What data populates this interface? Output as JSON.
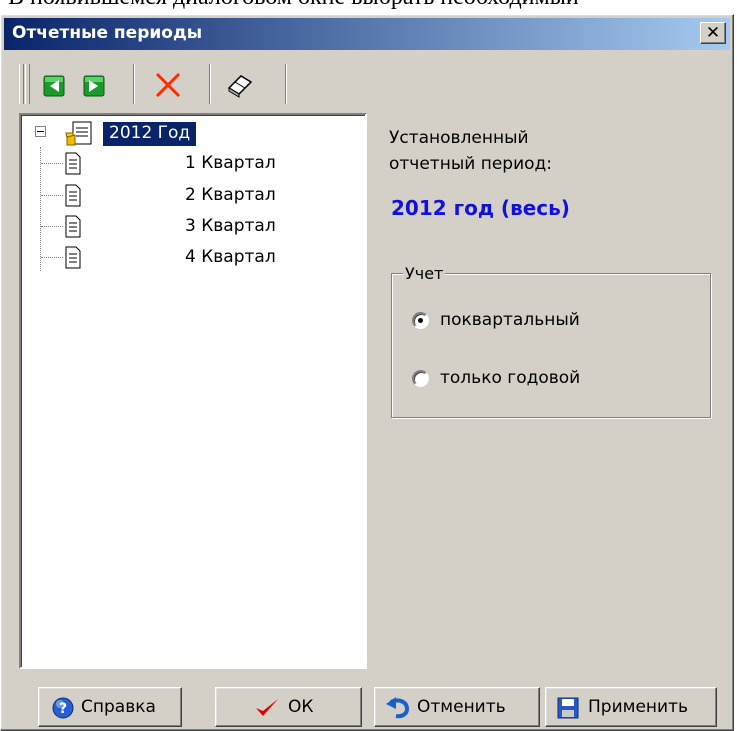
{
  "behind_text": "В появившемся диалоговом окне выбрать необходимый",
  "window": {
    "title": "Отчетные периоды",
    "close_label": "✕"
  },
  "toolbar": {
    "buttons": [
      {
        "name": "prev-period-button",
        "icon": "green-left-arrow-icon"
      },
      {
        "name": "next-period-button",
        "icon": "green-right-arrow-icon"
      },
      {
        "name": "delete-period-button",
        "icon": "red-cross-icon"
      },
      {
        "name": "edit-period-button",
        "icon": "eraser-icon"
      }
    ]
  },
  "tree": {
    "root": {
      "label": "2012 Год",
      "selected": true,
      "expanded": true
    },
    "children": [
      {
        "label": "1 Квартал"
      },
      {
        "label": "2 Квартал"
      },
      {
        "label": "3 Квартал"
      },
      {
        "label": "4 Квартал"
      }
    ]
  },
  "info": {
    "label": "Установленный отчетный период:",
    "value": "2012 год (весь)",
    "value_color": "#1010e0"
  },
  "accounting": {
    "title": "Учет",
    "options": [
      {
        "label": "поквартальный",
        "checked": true
      },
      {
        "label": "только годовой",
        "checked": false
      }
    ]
  },
  "buttons": {
    "help": "Справка",
    "ok": "ОК",
    "cancel": "Отменить",
    "apply": "Применить"
  },
  "colors": {
    "face": "#d4d0c8",
    "title_start": "#0a246a",
    "title_end": "#a6caf0",
    "selection": "#0a246a"
  }
}
